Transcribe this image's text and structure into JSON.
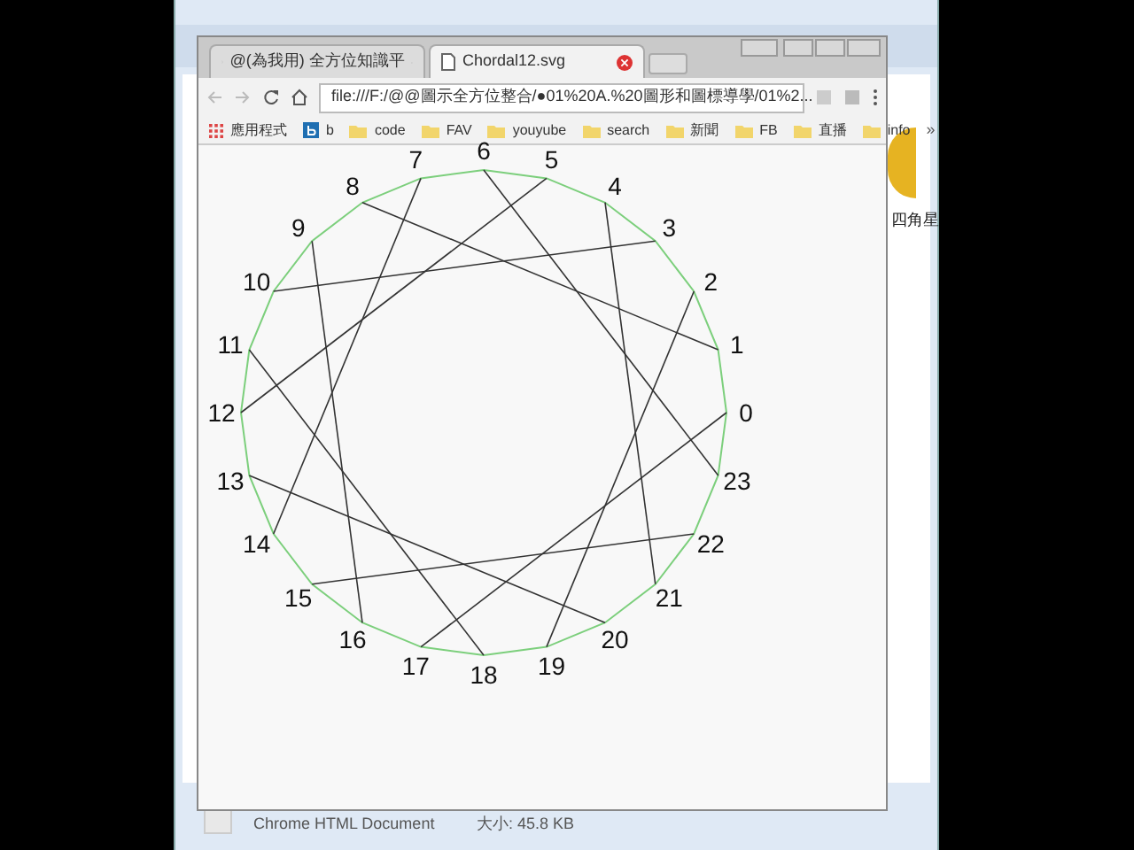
{
  "explorer": {
    "side_file_label": "四角星",
    "status_type": "Chrome HTML Document",
    "status_size": "大小: 45.8 KB"
  },
  "browser": {
    "tabs": [
      {
        "label": "@(為我用) 全方位知識平",
        "selected": false
      },
      {
        "label": "Chordal12.svg",
        "selected": true
      }
    ],
    "url": "file:///F:/@@圖示全方位整合/●01%20A.%20圖形和圖標導學/01%2...",
    "bookmarks": [
      {
        "label": "應用程式",
        "kind": "apps"
      },
      {
        "label": "b",
        "kind": "b"
      },
      {
        "label": "code",
        "kind": "folder"
      },
      {
        "label": "FAV",
        "kind": "folder"
      },
      {
        "label": "youyube",
        "kind": "folder"
      },
      {
        "label": "search",
        "kind": "folder"
      },
      {
        "label": "新聞",
        "kind": "folder"
      },
      {
        "label": "FB",
        "kind": "folder"
      },
      {
        "label": "直播",
        "kind": "folder"
      },
      {
        "label": "info",
        "kind": "folder"
      }
    ],
    "bookmarks_more": "»"
  },
  "diagram": {
    "nodes": [
      "0",
      "1",
      "2",
      "3",
      "4",
      "5",
      "6",
      "7",
      "8",
      "9",
      "10",
      "11",
      "12",
      "13",
      "14",
      "15",
      "16",
      "17",
      "18",
      "19",
      "20",
      "21",
      "22",
      "23"
    ]
  }
}
